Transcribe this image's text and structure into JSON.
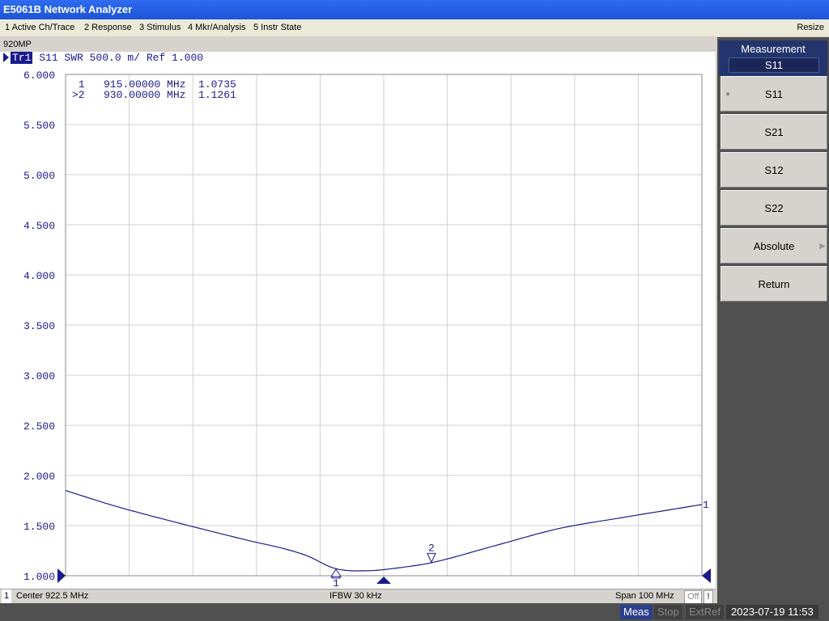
{
  "app": {
    "title": "E5061B Network Analyzer"
  },
  "menu": {
    "items": [
      "1 Active Ch/Trace",
      "2 Response",
      "3 Stimulus",
      "4 Mkr/Analysis",
      "5 Instr State"
    ],
    "resize": "Resize"
  },
  "channel": {
    "title": "920MP",
    "trace_label": "Tr1",
    "trace_info": "S11  SWR 500.0 m/ Ref 1.000",
    "ref_marker_label": "1"
  },
  "markers": [
    {
      "text": " 1   915.00000 MHz  1.0735",
      "label": "1"
    },
    {
      "text": ">2   930.00000 MHz  1.1261",
      "label": "2"
    }
  ],
  "chart_data": {
    "type": "line",
    "title": "",
    "xlabel": "",
    "ylabel": "SWR",
    "x_unit": "MHz",
    "xlim": [
      872.5,
      972.5
    ],
    "ylim": [
      1.0,
      6.0
    ],
    "yticks": [
      "6.000",
      "5.500",
      "5.000",
      "4.500",
      "4.000",
      "3.500",
      "3.000",
      "2.500",
      "2.000",
      "1.500",
      "1.000"
    ],
    "grid": true,
    "series": [
      {
        "x": [
          872.5,
          880,
          890,
          900,
          910,
          915,
          920,
          925,
          930,
          940,
          950,
          960,
          972.5
        ],
        "y": [
          1.85,
          1.7,
          1.53,
          1.37,
          1.21,
          1.07,
          1.05,
          1.08,
          1.13,
          1.3,
          1.47,
          1.58,
          1.71
        ]
      }
    ],
    "marker_points": [
      {
        "label": "1",
        "x": 915,
        "y": 1.0735
      },
      {
        "label": "2",
        "x": 930,
        "y": 1.1261
      }
    ]
  },
  "status": {
    "channel": "1",
    "center": "Center  922.5 MHz",
    "ifbw": "IFBW 30 kHz",
    "span": "Span 100 MHz",
    "off": "Off",
    "bang": "!"
  },
  "bottom": {
    "meas": "Meas",
    "stop": "Stop",
    "extref": "ExtRef",
    "clock": "2023-07-19 11:53"
  },
  "softkeys": {
    "header": "Measurement",
    "current": "S11",
    "items": [
      "S11",
      "S21",
      "S12",
      "S22",
      "Absolute",
      "Return"
    ]
  },
  "colors": {
    "trace": "#1a1a8c",
    "grid": "#d0d0d0",
    "header": "#23356c"
  }
}
